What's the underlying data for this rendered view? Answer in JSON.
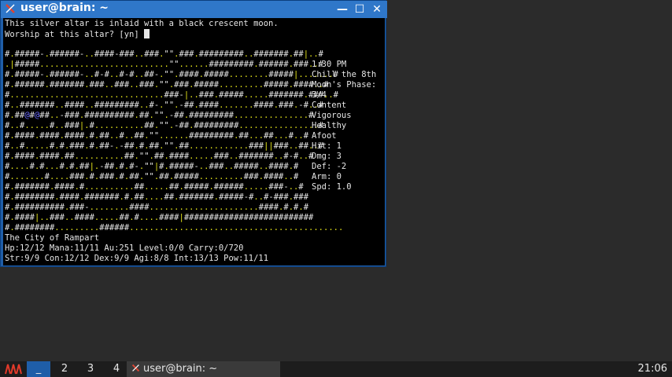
{
  "window": {
    "title": "user@brain: ~",
    "buttons": {
      "minimize": "—",
      "maximize": "☐",
      "close": "✕"
    }
  },
  "terminal": {
    "message_line1": "This silver altar is inlaid with a black crescent moon.",
    "message_line2": "Worship at this altar? [yn] ",
    "map_rows": [
      "#.#####-.######-..####-###..###.\"\".###.#########..#######.##|..#",
      ".|#####..........................\"\"......#########.######.###..#",
      "#.#####-.######-..#-#..#-#..##-.\"\".####.#####........#####|.......#",
      "#.######.#######.###..###..###.\"\".###.#####.........#####.####..#",
      "#...............................###-|..###.#####.....#######.###..#",
      "#..#######..####..#########..#-.\"\".-##.####.......####.###.-#..#",
      "#.##@#@##..-###.##########.##.\"\".-##.#########...............#",
      "#..#.....#..###|.#..........##.\"\".-##.#########................#",
      "#.####.####.####.#.##..#..##.\"\"......#########.##...##...#..#",
      "#..#.....#.#.###.#.##-.-##.#.##.\"\".##............###||###..##..#",
      "#.####.####.##..........##.\"\".##.####.....###..#######..#-#..#",
      "#....#.#...#.#.##|.-##.#.#-.\"\"|#.#####-..###..#####..####.#",
      "#.......#....###.#.###.#.##.\"\".##.#####.........###.####..#",
      "#.#######.####.#..........##.....##.#####.######.....###-..#",
      "#.########.####.#######.#.##....##.#######.#####-#..#-###.###",
      "#.##########.###-........####......................####.#.#.#",
      "#.####|..###..####.....##.#....####|##########################",
      "#.########.........######..........................................."
    ],
    "location": "The City of Rampart",
    "status_line1": "Hp:12/12 Mana:11/11 Au:251 Level:0/0 Carry:0/720",
    "status_line2": "Str:9/9 Con:12/12 Dex:9/9 Agi:8/8 Int:13/13 Pow:11/11"
  },
  "side_panel": {
    "time": "1:30 PM",
    "date": "Chill the 8th",
    "moon_label": "Moon's Phase:",
    "moon_value": "3/4",
    "blank1": "",
    "state1": "Content",
    "state2": "Vigorous",
    "state3": "Healthy",
    "state4": "Afoot",
    "blank2": "",
    "hit": "Hit: 1",
    "dmg": "Dmg: 3",
    "def": "Def: -2",
    "arm": "Arm: 0",
    "spd": "Spd: 1.0"
  },
  "taskbar": {
    "workspaces": [
      "_",
      "2",
      "3",
      "4"
    ],
    "task_label": "user@brain: ~",
    "clock": "21:06"
  },
  "colors": {
    "accent": "#2f77c9",
    "terminal_bg": "#000000",
    "altar_yellow": "#e6e61a",
    "player_blue": "#6a6aff"
  }
}
